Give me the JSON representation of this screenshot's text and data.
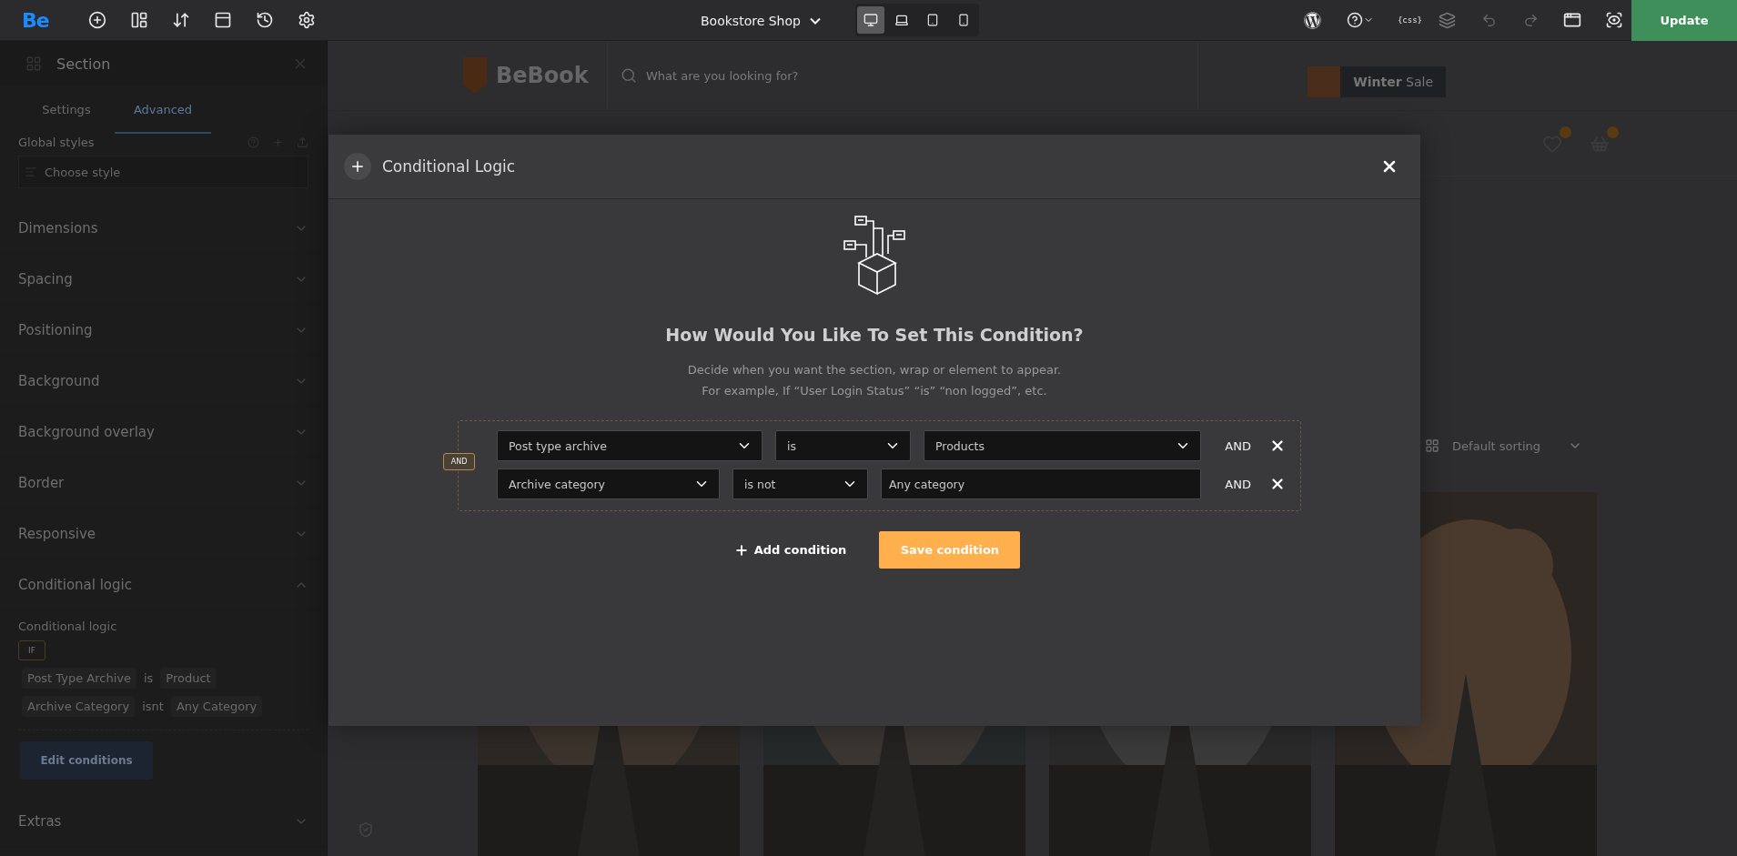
{
  "toolbar": {
    "logo": "Be",
    "site": "Bookstore Shop",
    "devices": [
      {
        "selected": true
      },
      {
        "selected": false
      },
      {
        "selected": false
      },
      {
        "selected": false
      }
    ],
    "css_button": "{css}",
    "history": [
      {
        "disabled": true
      },
      {
        "disabled": true
      }
    ],
    "update": "Update"
  },
  "sidebar": {
    "title": "Section",
    "tabs": [
      {
        "label": "Settings",
        "selected": false
      },
      {
        "label": "Advanced",
        "selected": true
      }
    ],
    "global_styles": {
      "label": "Global styles",
      "placeholder": "Choose style"
    },
    "sections": [
      {
        "label": "Dimensions",
        "expanded": false
      },
      {
        "label": "Spacing",
        "expanded": false
      },
      {
        "label": "Positioning",
        "expanded": false
      },
      {
        "label": "Background",
        "expanded": false
      },
      {
        "label": "Background overlay",
        "expanded": false
      },
      {
        "label": "Border",
        "expanded": false
      },
      {
        "label": "Responsive",
        "expanded": false
      },
      {
        "label": "Conditional logic",
        "expanded": true
      },
      {
        "label": "Extras",
        "expanded": false
      }
    ],
    "conditional_logic": {
      "label": "Conditional logic",
      "badge": "IF",
      "rules": [
        {
          "field": "Post Type Archive",
          "operator": "is",
          "value": "Product"
        },
        {
          "field": "Archive Category",
          "operator": "isnt",
          "value": "Any Category"
        }
      ],
      "button": "Edit conditions"
    }
  },
  "page": {
    "logo": "BeBook",
    "search_placeholder": "What are you looking for?",
    "promo": "**Winter** Sale",
    "sorting": "Default sorting"
  },
  "modal": {
    "title": "Conditional Logic",
    "heading": "How Would You Like To Set This Condition?",
    "description": [
      "Decide when you want the section, wrap or element to appear.",
      "For example, If “User Login Status” “is” “non logged”, etc."
    ],
    "group_badge": "AND",
    "conditions": [
      {
        "field": "Post type archive",
        "operator": "is",
        "value": {
          "kind": "select",
          "text": "Products"
        },
        "joiner": "AND"
      },
      {
        "field": "Archive category",
        "operator": "is not",
        "value": {
          "kind": "input",
          "text": "Any category"
        },
        "joiner": "AND"
      }
    ],
    "add_button": "Add condition",
    "save_button": "Save condition"
  }
}
